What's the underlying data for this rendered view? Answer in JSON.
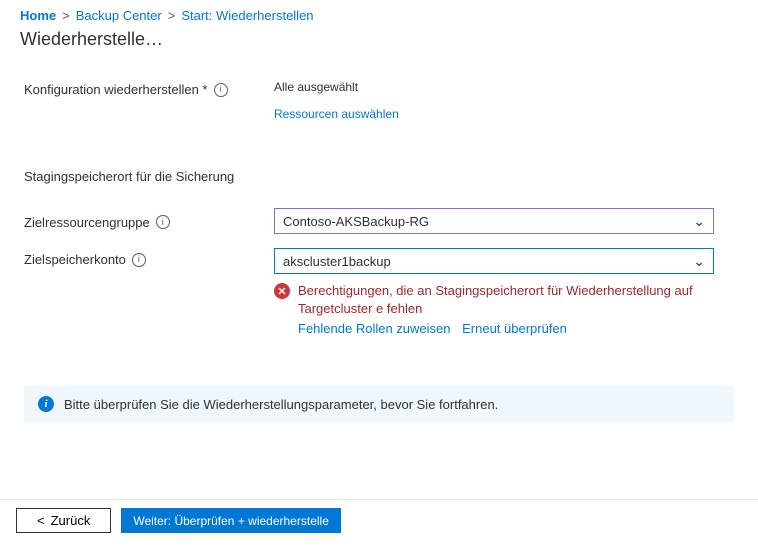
{
  "breadcrumb": {
    "home": "Home",
    "sep": ">",
    "backup_center": "Backup Center",
    "start_restore": "Start: Wiederherstellen"
  },
  "page_title": "Wiederherstelle…",
  "config_section": {
    "label": "Konfiguration wiederherstellen *",
    "value_text": "Alle ausgewählt",
    "select_link": "Ressourcen auswählen"
  },
  "staging": {
    "title": "Stagingspeicherort für die Sicherung",
    "rg_label": "Zielressourcengruppe",
    "rg_value": "Contoso-AKSBackup-RG",
    "sa_label": "Zielspeicherkonto",
    "sa_value": "akscluster1backup",
    "error": {
      "text": "Berechtigungen, die an Stagingspeicherort für Wiederherstellung auf Targetcluster e fehlen",
      "link_assign": "Fehlende Rollen zuweisen",
      "link_retry": "Erneut überprüfen"
    }
  },
  "banner": {
    "text": "Bitte überprüfen Sie die Wiederherstellungsparameter, bevor Sie fortfahren."
  },
  "footer": {
    "back": "Zurück",
    "next": "Weiter: Überprüfen + wiederherstelle"
  },
  "icons": {
    "info": "i",
    "error": "✕",
    "chevron_left": "<",
    "chevron_down": "⌄"
  }
}
